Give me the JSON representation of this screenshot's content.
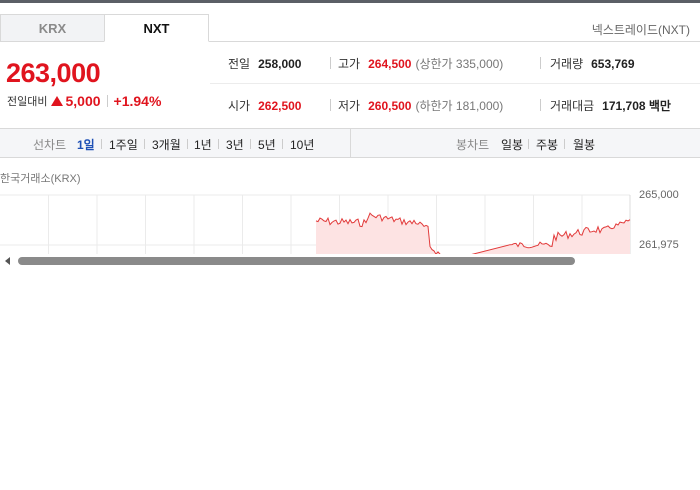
{
  "tabs": [
    {
      "label": "KRX",
      "active": false
    },
    {
      "label": "NXT",
      "active": true
    }
  ],
  "market_name": "넥스트레이드(NXT)",
  "price": {
    "current": "263,000",
    "change_label": "전일대비",
    "change_direction": "up",
    "change_value": "5,000",
    "change_percent": "+1.94%"
  },
  "stats": {
    "prev_close": {
      "label": "전일",
      "value": "258,000"
    },
    "high": {
      "label": "고가",
      "value": "264,500",
      "sub": "(상한가 335,000)"
    },
    "volume": {
      "label": "거래량",
      "value": "653,769"
    },
    "open": {
      "label": "시가",
      "value": "262,500"
    },
    "low": {
      "label": "저가",
      "value": "260,500",
      "sub": "(하한가 181,000)"
    },
    "trade_amount": {
      "label": "거래대금",
      "value": "171,708 백만"
    }
  },
  "toolbar": {
    "line_label": "선차트",
    "line_periods": [
      "1일",
      "1주일",
      "3개월",
      "1년",
      "3년",
      "5년",
      "10년"
    ],
    "active_period": "1일",
    "candle_label": "봉차트",
    "candle_periods": [
      "일봉",
      "주봉",
      "월봉"
    ]
  },
  "chart": {
    "source": "한국거래소(KRX)",
    "y_ticks": [
      "265,000",
      "261,975"
    ]
  },
  "colors": {
    "up": "#e0141e",
    "active_period": "#1d4fb5",
    "chart_line": "#e23a3a",
    "chart_fill": "#fde3e3"
  }
}
